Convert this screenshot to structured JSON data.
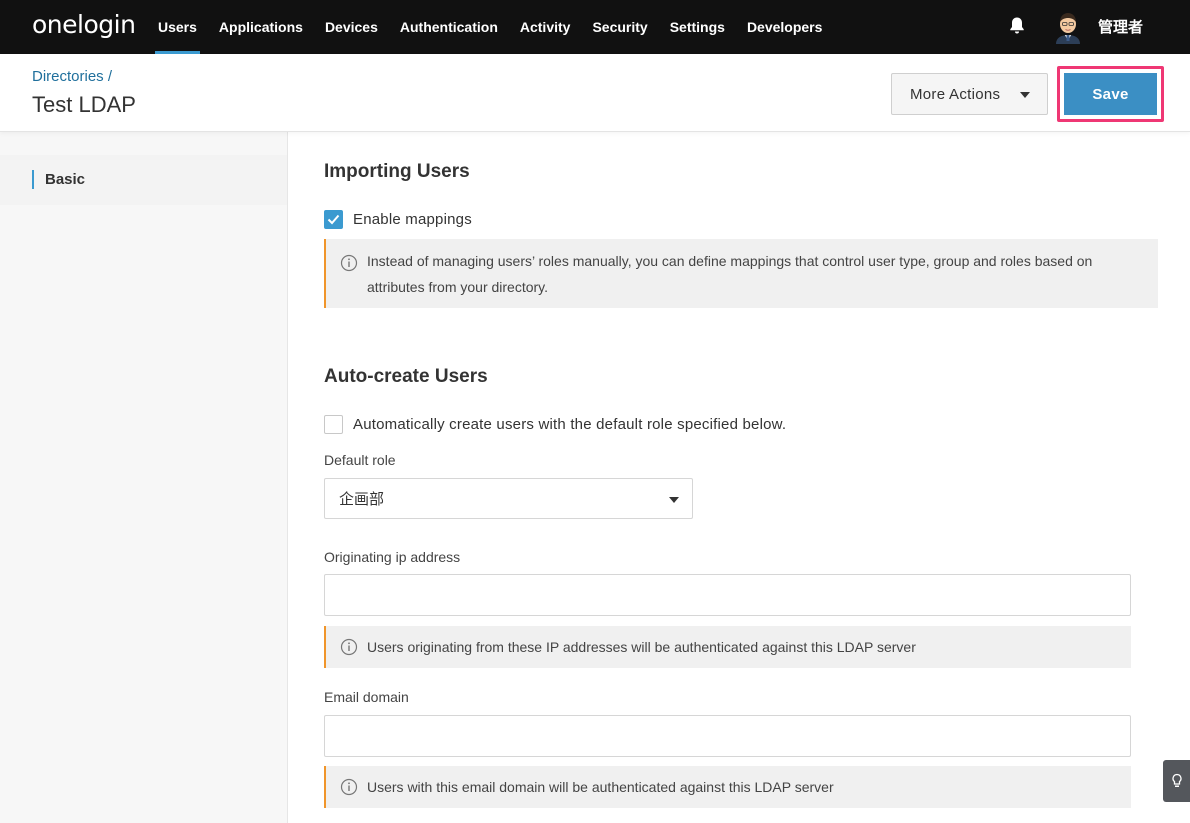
{
  "brand": {
    "logo_text": "onelogin"
  },
  "nav": {
    "items": [
      {
        "label": "Users",
        "active": true
      },
      {
        "label": "Applications"
      },
      {
        "label": "Devices"
      },
      {
        "label": "Authentication"
      },
      {
        "label": "Activity"
      },
      {
        "label": "Security"
      },
      {
        "label": "Settings"
      },
      {
        "label": "Developers"
      }
    ],
    "icons": {
      "bell": "bell-icon",
      "avatar": "avatar"
    },
    "username": "管理者"
  },
  "header": {
    "breadcrumb": "Directories /",
    "title": "Test LDAP",
    "more_actions_label": "More Actions",
    "save_label": "Save"
  },
  "sidebar": {
    "items": [
      {
        "label": "Basic",
        "active": true
      }
    ]
  },
  "importing": {
    "title": "Importing Users",
    "enable_mappings_label": "Enable mappings",
    "enable_mappings_checked": true,
    "info_line1": "Instead of managing users’ roles manually, you can define mappings that control user type, group and roles based on",
    "info_line2": "attributes from your directory."
  },
  "autocreate": {
    "title": "Auto-create Users",
    "auto_create_label": "Automatically create users with the default role specified below.",
    "auto_create_checked": false,
    "default_role_label": "Default role",
    "default_role_value": "企画部",
    "ip_label": "Originating ip address",
    "ip_value": "",
    "ip_info": "Users originating from these IP addresses will be authenticated against this LDAP server",
    "email_label": "Email domain",
    "email_value": "",
    "email_info": "Users with this email domain will be authenticated against this LDAP server"
  },
  "colors": {
    "accent": "#3b9ad0",
    "save": "#3b8fc4",
    "highlight": "#ef3774",
    "info_border": "#f0952b"
  }
}
